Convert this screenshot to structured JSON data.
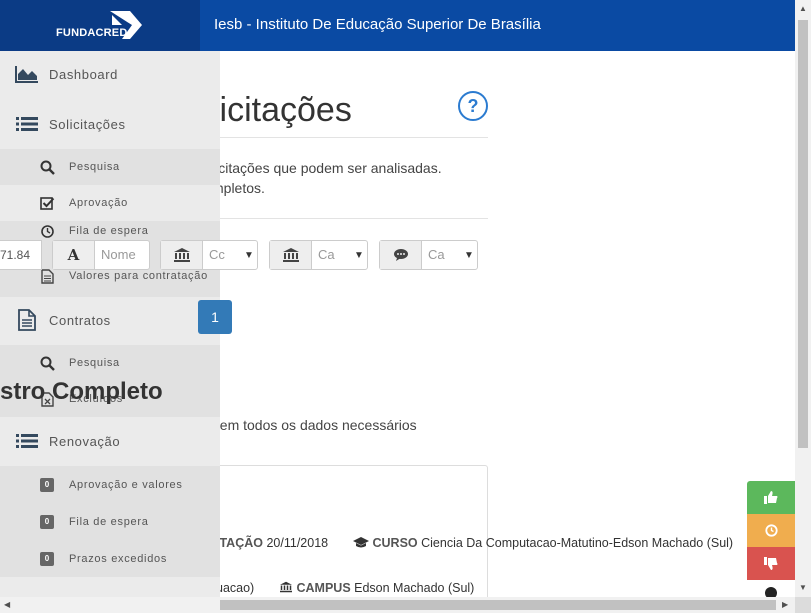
{
  "header": {
    "logo_text": "FUNDACRED",
    "title": "Iesb - Instituto De Educação Superior De Brasília"
  },
  "main": {
    "page_title": "licitações",
    "help_label": "?",
    "description_line1": "licitações que podem ser analisadas.",
    "description_line2": "mpletos.",
    "filters": {
      "value_text": "71.84",
      "name_placeholder": "Nome",
      "select_1": "Cc",
      "select_2": "Ca",
      "select_3": "Ca"
    },
    "badge_count": "1",
    "section_title": "stro Completo",
    "section_description": "uem todos os dados necessários",
    "card": {
      "date_label": "ITAÇÃO",
      "date_value": "20/11/2018",
      "course_label": "CURSO",
      "course_value": "Ciencia Da Computacao-Matutino-Edson Machado (Sul)",
      "partial_text": "uacao)",
      "campus_label": "CAMPUS",
      "campus_value": "Edson Machado (Sul)"
    }
  },
  "sidebar": {
    "dashboard": "Dashboard",
    "solicitacoes": "Solicitações",
    "sol_pesquisa": "Pesquisa",
    "sol_aprovacao": "Aprovação",
    "sol_fila": "Fila de espera",
    "sol_valores": "Valores para contratação",
    "contratos": "Contratos",
    "con_pesquisa": "Pesquisa",
    "con_excluidos": "Excluídos",
    "renovacao": "Renovação",
    "ren_aprovacao": "Aprovação e valores",
    "ren_fila": "Fila de espera",
    "ren_prazos": "Prazos excedidos",
    "zero": "0"
  },
  "colors": {
    "header_blue": "#0a4aa3",
    "logo_blue": "#0b3b85",
    "success": "#5cb85c",
    "warning": "#f0ad4e",
    "danger": "#d9534f",
    "badge_blue": "#337ab7"
  },
  "icons": {
    "dashboard": "area-chart-icon",
    "solicitacoes": "list-icon",
    "contratos": "document-icon",
    "renovacao": "list-icon",
    "pesquisa": "search-icon",
    "aprovacao": "check-square-icon",
    "fila": "clock-icon",
    "valores": "file-icon",
    "excluidos": "excel-file-icon"
  }
}
